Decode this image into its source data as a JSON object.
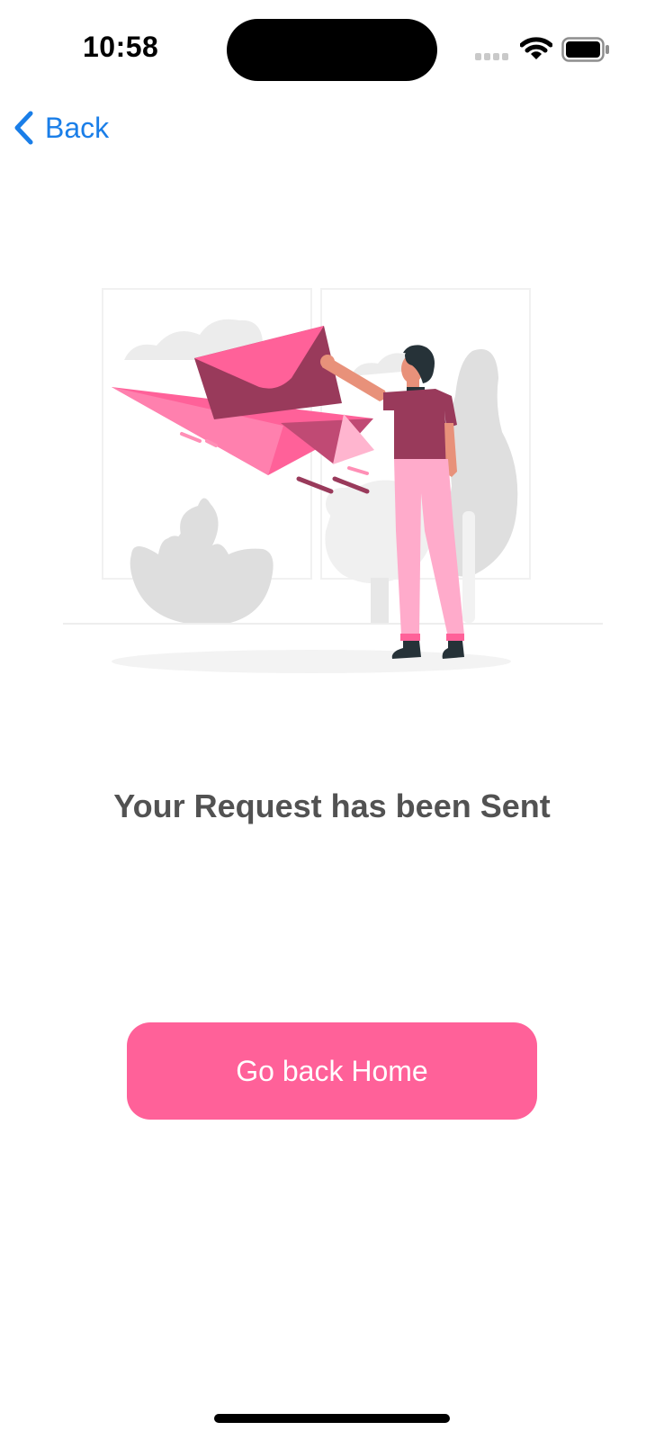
{
  "status_bar": {
    "time": "10:58",
    "icons": [
      "cellular-signal-icon",
      "wifi-icon",
      "battery-icon"
    ]
  },
  "nav": {
    "back_label": "Back",
    "back_icon": "chevron-left-icon"
  },
  "illustration": {
    "name": "person-sending-envelope-illustration"
  },
  "main": {
    "heading": "Your Request has been Sent",
    "button_label": "Go back Home"
  },
  "colors": {
    "accent_pink": "#ff6199",
    "link_blue": "#1a7ee8",
    "heading_gray": "#525252",
    "illustration_maroon": "#993a5b",
    "illustration_light_pink": "#ffabcb"
  }
}
